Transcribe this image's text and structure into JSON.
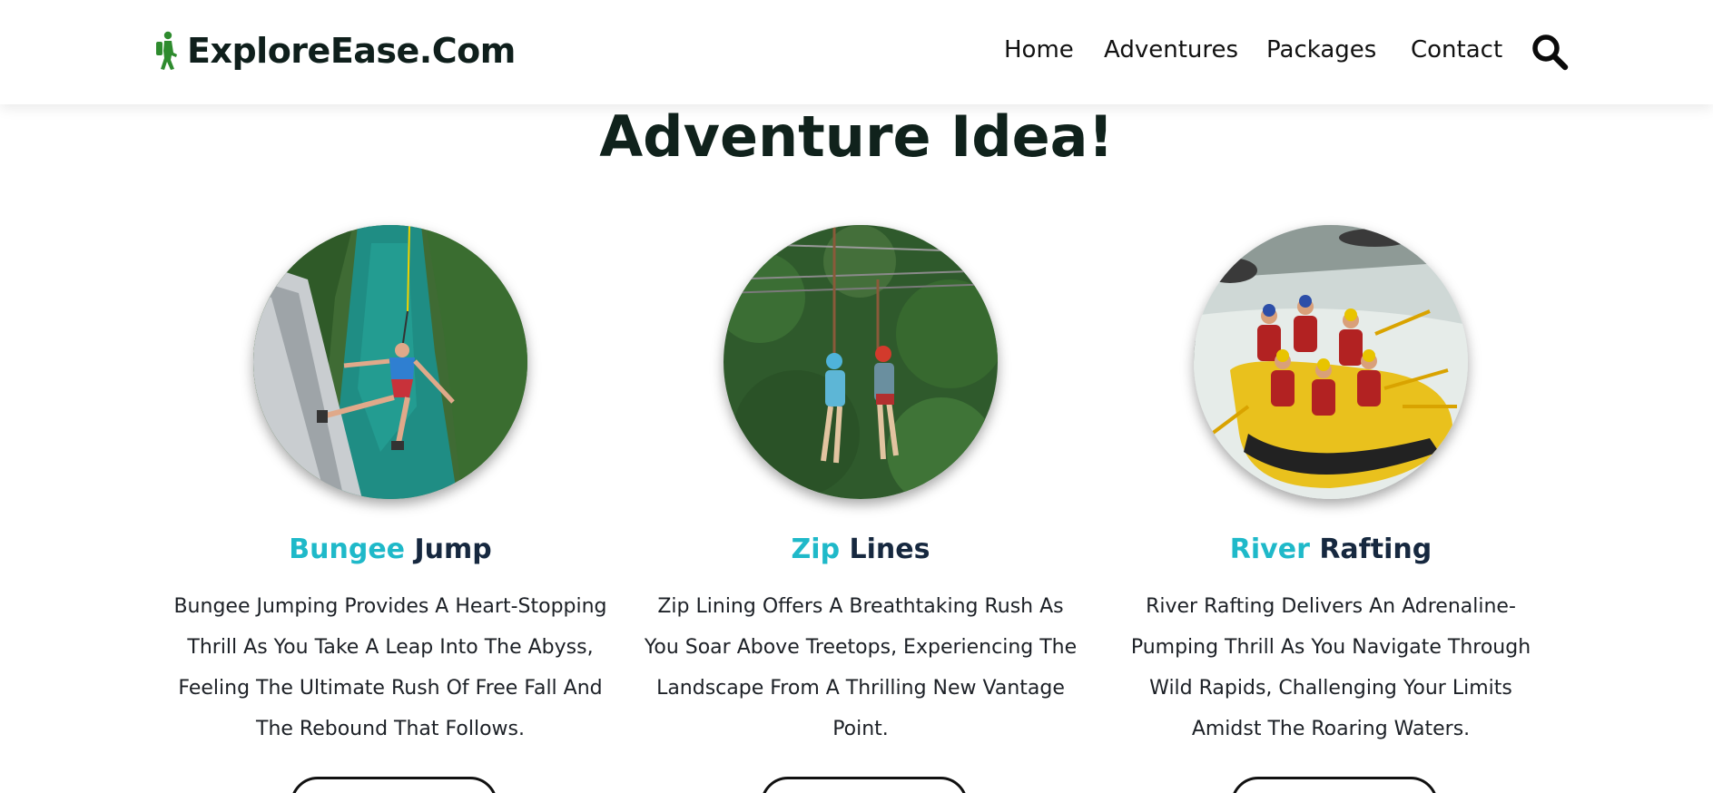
{
  "brand": {
    "name": "ExploreEase.Com",
    "icon": "hiker-icon",
    "color": "#2e8b2e"
  },
  "nav": {
    "items": [
      {
        "label": "Home"
      },
      {
        "label": "Adventures"
      },
      {
        "label": "Packages"
      },
      {
        "label": "Contact"
      }
    ],
    "search_icon": "search-icon"
  },
  "section": {
    "title": "Adventure Idea!"
  },
  "cards": [
    {
      "title_accent": "Bungee",
      "title_rest": " Jump",
      "description": "Bungee Jumping Provides A Heart-Stopping Thrill As You Take A Leap Into The Abyss, Feeling The Ultimate Rush Of Free Fall And The Rebound That Follows.",
      "image": "bungee-jump-photo"
    },
    {
      "title_accent": "Zip",
      "title_rest": " Lines",
      "description": "Zip Lining Offers A Breathtaking Rush As You Soar Above Treetops, Experiencing The Landscape From A Thrilling New Vantage Point.",
      "image": "zip-line-photo"
    },
    {
      "title_accent": "River",
      "title_rest": " Rafting",
      "description": "River Rafting Delivers An Adrenaline-Pumping Thrill As You Navigate Through Wild Rapids, Challenging Your Limits Amidst The Roaring Waters.",
      "image": "river-rafting-photo"
    }
  ],
  "colors": {
    "accent": "#1fb9c9",
    "title_dark": "#16283f",
    "heading": "#10221c"
  }
}
